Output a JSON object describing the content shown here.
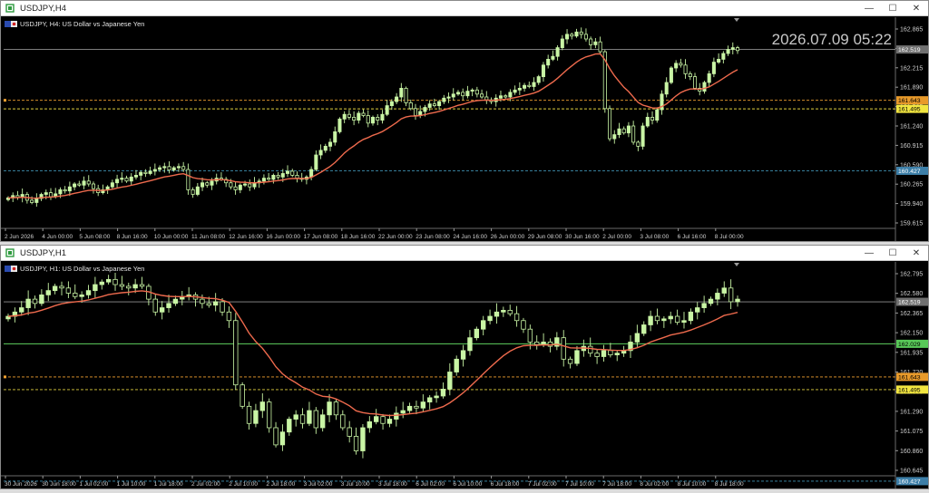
{
  "colors": {
    "up_candle": "#c9f5a5",
    "down_candle": "#000000",
    "wick": "#c9f5a5",
    "ma": "#ee6a4d",
    "grid_text": "#cfcfcf",
    "orange_line": "#f0a030",
    "yellow_line": "#e0d040",
    "cyan_line": "#3f8fb0",
    "green_line": "#5fd05f",
    "bid_line": "#8f8f8f"
  },
  "windows": [
    {
      "title": "USDJPY,H4",
      "symbol_label": "USDJPY, H4:  US Dollar vs Japanese Yen",
      "controls": {
        "minimize": "—",
        "maximize": "☐",
        "close": "✕"
      },
      "clock_label": "2026.07.09 05:22",
      "price_labels": [
        "162.865",
        "162.540",
        "162.215",
        "161.890",
        "161.565",
        "161.240",
        "160.915",
        "160.590",
        "160.265",
        "159.940",
        "159.615"
      ],
      "price_range": [
        159.45,
        162.95
      ],
      "time_labels": [
        "2 Jun 2026",
        "4 Jun 00:00",
        "5 Jun 08:00",
        "8 Jun 16:00",
        "10 Jun 00:00",
        "11 Jun 08:00",
        "12 Jun 16:00",
        "16 Jun 00:00",
        "17 Jun 08:00",
        "18 Jun 16:00",
        "22 Jun 00:00",
        "23 Jun 08:00",
        "24 Jun 16:00",
        "26 Jun 00:00",
        "29 Jun 08:00",
        "30 Jun 16:00",
        "2 Jul 00:00",
        "3 Jul 08:00",
        "6 Jul 16:00",
        "8 Jul 00:00"
      ],
      "levels": [
        {
          "price": 162.519,
          "label": "162.519",
          "kind": "bid"
        },
        {
          "price": 161.643,
          "label": "161.643",
          "kind": "orange"
        },
        {
          "price": 161.495,
          "label": "161.495",
          "kind": "yellow"
        },
        {
          "price": 160.427,
          "label": "160.427",
          "kind": "cyan"
        }
      ],
      "close_series": [
        159.96,
        160.0,
        159.97,
        160.02,
        159.92,
        159.88,
        159.95,
        160.02,
        160.05,
        159.98,
        160.03,
        160.1,
        160.08,
        160.15,
        160.2,
        160.18,
        160.25,
        160.2,
        160.12,
        160.05,
        160.1,
        160.15,
        160.22,
        160.28,
        160.3,
        160.25,
        160.32,
        160.35,
        160.4,
        160.38,
        160.42,
        160.45,
        160.48,
        160.5,
        160.44,
        160.48,
        160.5,
        160.45,
        160.1,
        160.02,
        160.15,
        160.22,
        160.18,
        160.25,
        160.3,
        160.28,
        160.22,
        160.15,
        160.1,
        160.18,
        160.2,
        160.15,
        160.22,
        160.25,
        160.3,
        160.28,
        160.35,
        160.32,
        160.38,
        160.42,
        160.35,
        160.3,
        160.28,
        160.32,
        160.45,
        160.7,
        160.78,
        160.85,
        160.92,
        161.1,
        161.32,
        161.4,
        161.35,
        161.3,
        161.42,
        161.38,
        161.25,
        161.35,
        161.3,
        161.4,
        161.55,
        161.62,
        161.7,
        161.85,
        161.6,
        161.5,
        161.38,
        161.45,
        161.52,
        161.58,
        161.55,
        161.62,
        161.68,
        161.7,
        161.75,
        161.78,
        161.72,
        161.8,
        161.82,
        161.75,
        161.7,
        161.65,
        161.62,
        161.68,
        161.72,
        161.7,
        161.78,
        161.82,
        161.85,
        161.9,
        161.88,
        161.95,
        162.05,
        162.25,
        162.35,
        162.4,
        162.55,
        162.7,
        162.78,
        162.75,
        162.82,
        162.78,
        162.7,
        162.6,
        162.65,
        162.48,
        161.5,
        160.98,
        161.05,
        161.15,
        161.08,
        161.2,
        160.92,
        160.85,
        161.2,
        161.35,
        161.3,
        161.48,
        161.75,
        161.95,
        162.2,
        162.28,
        162.25,
        162.1,
        162.05,
        161.85,
        161.8,
        161.95,
        162.1,
        162.3,
        162.35,
        162.45,
        162.52,
        162.55,
        162.5
      ]
    },
    {
      "title": "USDJPY,H1",
      "symbol_label": "USDJPY, H1:  US Dollar vs Japanese Yen",
      "controls": {
        "minimize": "—",
        "maximize": "☐",
        "close": "✕"
      },
      "price_labels": [
        "162.795",
        "162.580",
        "162.365",
        "162.150",
        "161.935",
        "161.720",
        "161.505",
        "161.290",
        "161.075",
        "160.860",
        "160.645"
      ],
      "price_range": [
        160.5,
        162.9
      ],
      "time_labels": [
        "30 Jun 2026",
        "30 Jun 18:00",
        "1 Jul 02:00",
        "1 Jul 10:00",
        "1 Jul 18:00",
        "2 Jul 02:00",
        "2 Jul 10:00",
        "2 Jul 18:00",
        "3 Jul 02:00",
        "3 Jul 10:00",
        "3 Jul 18:00",
        "6 Jul 02:00",
        "6 Jul 10:00",
        "6 Jul 18:00",
        "7 Jul 02:00",
        "7 Jul 10:00",
        "7 Jul 18:00",
        "8 Jul 02:00",
        "8 Jul 10:00",
        "8 Jul 18:00"
      ],
      "levels": [
        {
          "price": 162.519,
          "label": "162.519",
          "kind": "bid"
        },
        {
          "price": 162.029,
          "label": "162.029",
          "kind": "green"
        },
        {
          "price": 161.643,
          "label": "161.643",
          "kind": "orange"
        },
        {
          "price": 161.495,
          "label": "161.495",
          "kind": "yellow"
        },
        {
          "price": 160.427,
          "label": "160.427",
          "kind": "cyan"
        }
      ],
      "close_series": [
        162.35,
        162.4,
        162.45,
        162.55,
        162.5,
        162.6,
        162.65,
        162.7,
        162.68,
        162.62,
        162.58,
        162.6,
        162.65,
        162.72,
        162.75,
        162.78,
        162.72,
        162.7,
        162.68,
        162.72,
        162.7,
        162.55,
        162.4,
        162.45,
        162.5,
        162.55,
        162.58,
        162.6,
        162.55,
        162.5,
        162.48,
        162.52,
        162.4,
        162.3,
        161.55,
        161.3,
        161.1,
        161.25,
        161.35,
        161.05,
        160.85,
        161.0,
        161.15,
        161.2,
        161.1,
        161.25,
        161.05,
        161.2,
        161.35,
        161.2,
        161.05,
        160.95,
        160.78,
        161.05,
        161.12,
        161.18,
        161.1,
        161.15,
        161.22,
        161.25,
        161.3,
        161.28,
        161.35,
        161.4,
        161.42,
        161.5,
        161.7,
        161.85,
        161.95,
        162.1,
        162.2,
        162.3,
        162.35,
        162.4,
        162.42,
        162.38,
        162.3,
        162.2,
        162.05,
        162.02,
        162.05,
        162.0,
        162.1,
        161.85,
        161.8,
        161.95,
        162.0,
        161.92,
        161.88,
        161.95,
        161.9,
        161.92,
        161.95,
        162.05,
        162.15,
        162.25,
        162.35,
        162.3,
        162.32,
        162.35,
        162.28,
        162.3,
        162.4,
        162.45,
        162.5,
        162.55,
        162.62,
        162.68,
        162.52,
        162.55
      ]
    }
  ]
}
